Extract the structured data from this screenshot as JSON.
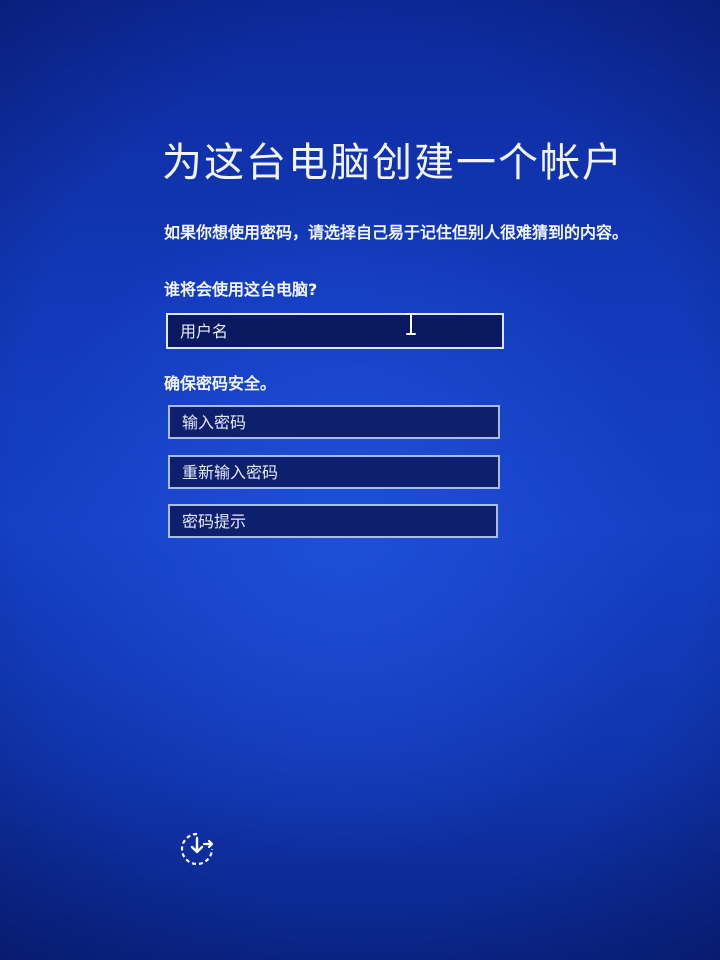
{
  "title": "为这台电脑创建一个帐户",
  "subtitle": "如果你想使用密码，请选择自己易于记住但别人很难猜到的内容。",
  "user_section": {
    "label": "谁将会使用这台电脑?",
    "username_placeholder": "用户名"
  },
  "password_section": {
    "label": "确保密码安全。",
    "password_placeholder": "输入密码",
    "repeat_placeholder": "重新输入密码",
    "hint_placeholder": "密码提示"
  },
  "icons": {
    "cursor": "text-cursor-icon",
    "accessibility": "ease-of-access-icon"
  },
  "colors": {
    "background": "#1238b8",
    "field_fill": "#0e1f6e",
    "field_border": "#a9bde8",
    "text": "#ffffff"
  }
}
